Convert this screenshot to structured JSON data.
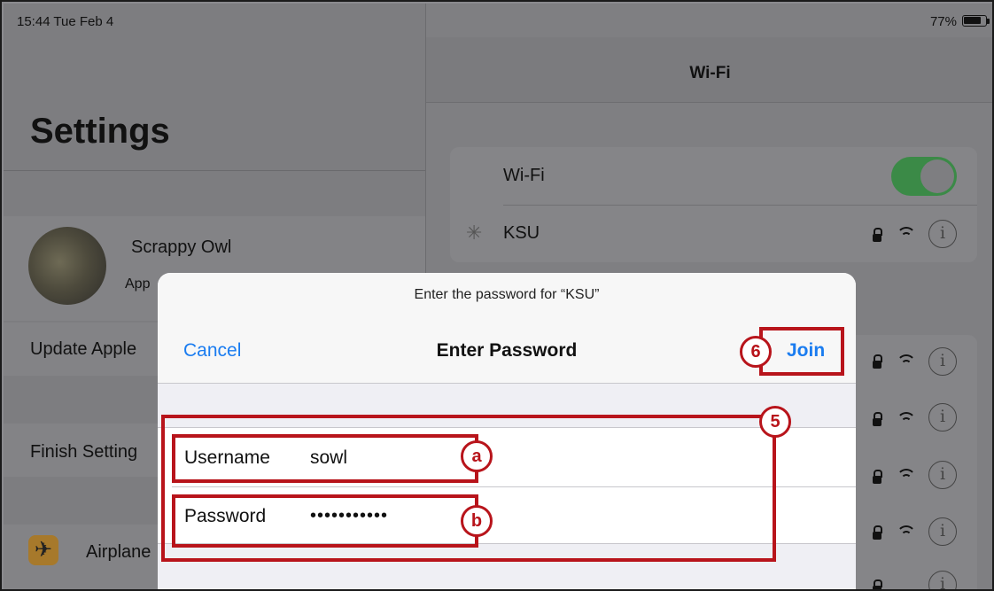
{
  "status_bar": {
    "time": "15:44  Tue Feb 4",
    "battery": "77%"
  },
  "settings": {
    "title": "Settings",
    "profile_name": "Scrappy Owl",
    "profile_sub": "App",
    "update_label": "Update Apple",
    "finish_label": "Finish Setting",
    "airplane_label": "Airplane"
  },
  "wifi_pane": {
    "nav_title": "Wi-Fi",
    "wifi_toggle_label": "Wi-Fi",
    "wifi_enabled": true,
    "connecting_network": "KSU",
    "info_glyph": "i"
  },
  "dialog": {
    "prompt": "Enter the password for “KSU”",
    "title": "Enter Password",
    "cancel_label": "Cancel",
    "join_label": "Join",
    "username_label": "Username",
    "username_value": "sowl",
    "password_label": "Password",
    "password_value": "•••••••••••"
  },
  "annotations": {
    "step_join": "6",
    "step_fields": "5",
    "marker_username": "a",
    "marker_password": "b",
    "color": "#b8141b"
  }
}
